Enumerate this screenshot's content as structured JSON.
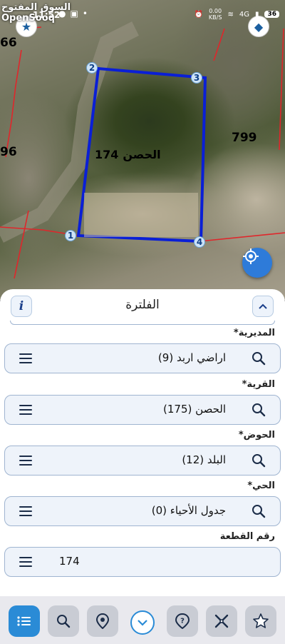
{
  "status_bar": {
    "time": "11:52",
    "network_speed": "0.00",
    "network_speed_unit": "KB/S",
    "signal_label": "4G",
    "battery": "36"
  },
  "watermark": {
    "arabic": "السوق المفتوح",
    "brand": "OpenSooq"
  },
  "map": {
    "plot_number": "174",
    "plot_name": "الحصن",
    "neighbor_right": "799",
    "neighbor_left_top": "66",
    "neighbor_left_mid": "96",
    "vertices": [
      "1",
      "2",
      "3",
      "4"
    ],
    "colors": {
      "parcel_outline": "#0a1fd6",
      "boundary_lines": "#e0262b",
      "locate_button": "#2e7bd9"
    }
  },
  "panel": {
    "title": "الفلترة",
    "info_label": "i",
    "collapse_icon": "chevron-up-icon",
    "fields": [
      {
        "label": "المديرية*",
        "value": "اراضي اربد (9)"
      },
      {
        "label": "القرية*",
        "value": "الحصن (175)"
      },
      {
        "label": "الحوض*",
        "value": "البلد (12)"
      },
      {
        "label": "الحي*",
        "value": "جدول الأحياء (0)"
      },
      {
        "label": "رقم القطعة",
        "value": "174"
      }
    ]
  },
  "toolbar": {
    "buttons": [
      "list-icon",
      "search-icon",
      "location-pin-icon",
      "chevron-down-icon",
      "help-icon",
      "ruler-icon",
      "star-icon"
    ],
    "active_color": "#2a8bd6"
  }
}
